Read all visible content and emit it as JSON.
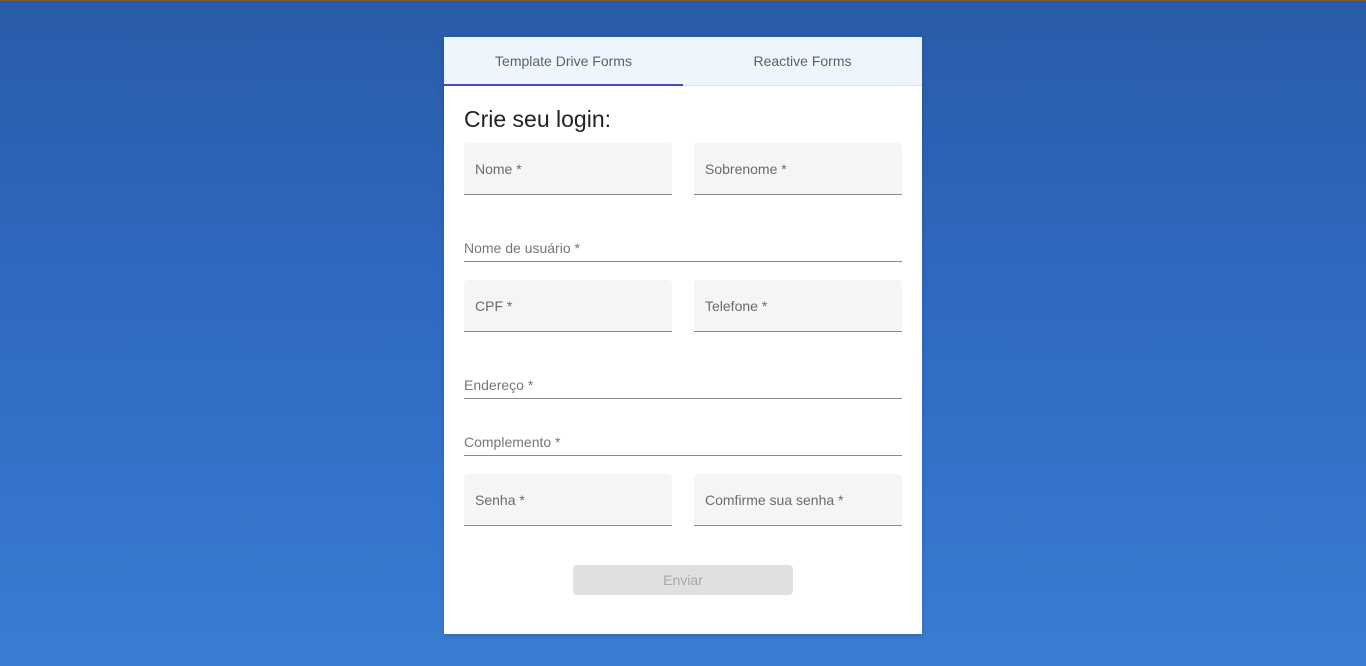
{
  "tabs": [
    {
      "label": "Template Drive Forms",
      "active": true
    },
    {
      "label": "Reactive Forms",
      "active": false
    }
  ],
  "form": {
    "title": "Crie seu login:",
    "fields": {
      "nome": "Nome *",
      "sobrenome": "Sobrenome *",
      "usuario": "Nome de usuário *",
      "cpf": "CPF *",
      "telefone": "Telefone *",
      "endereco": "Endereço *",
      "complemento": "Complemento *",
      "senha": "Senha *",
      "confirmar_senha": "Comfirme sua senha *"
    },
    "submit_label": "Enviar"
  },
  "colors": {
    "accent": "#3f51b5",
    "background_top": "#2a5ba8",
    "background_bottom": "#3a7dd4"
  }
}
